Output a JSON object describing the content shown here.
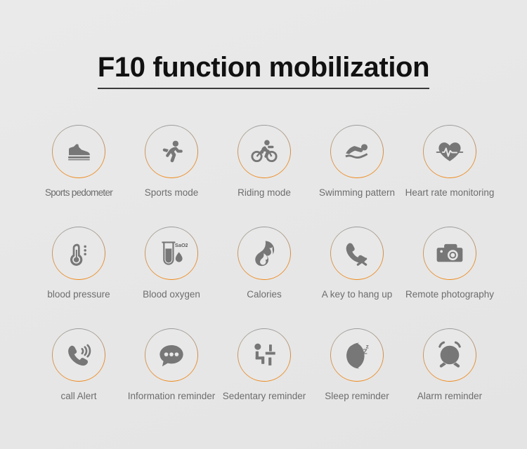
{
  "header": {
    "title": "F10 function mobilization"
  },
  "colors": {
    "background": "#e8e8e8",
    "accent_orange": "#ef8a1e",
    "ring_grey": "#9a9a9a",
    "icon_grey": "#777777",
    "title_text": "#111111",
    "label_text": "#6d6d6d"
  },
  "features": [
    {
      "label": "Sports pedometer",
      "icon": "sneaker-icon"
    },
    {
      "label": "Sports mode",
      "icon": "running-person-icon"
    },
    {
      "label": "Riding mode",
      "icon": "cyclist-icon"
    },
    {
      "label": "Swimming pattern",
      "icon": "swimmer-icon"
    },
    {
      "label": "Heart rate monitoring",
      "icon": "heart-ecg-icon"
    },
    {
      "label": "blood pressure",
      "icon": "thermometer-icon"
    },
    {
      "label": "Blood oxygen",
      "icon": "test-tube-sao2-icon",
      "icon_text": "SaO2"
    },
    {
      "label": "Calories",
      "icon": "flame-icon"
    },
    {
      "label": "A key to hang up",
      "icon": "phone-hangup-icon"
    },
    {
      "label": "Remote photography",
      "icon": "camera-icon"
    },
    {
      "label": "call  Alert",
      "icon": "phone-ringing-icon"
    },
    {
      "label": "Information reminder",
      "icon": "speech-bubble-dots-icon"
    },
    {
      "label": "Sedentary reminder",
      "icon": "sitting-person-desk-icon"
    },
    {
      "label": "Sleep reminder",
      "icon": "moon-zzz-icon",
      "icon_text": "zZz"
    },
    {
      "label": "Alarm reminder",
      "icon": "alarm-clock-icon"
    }
  ]
}
